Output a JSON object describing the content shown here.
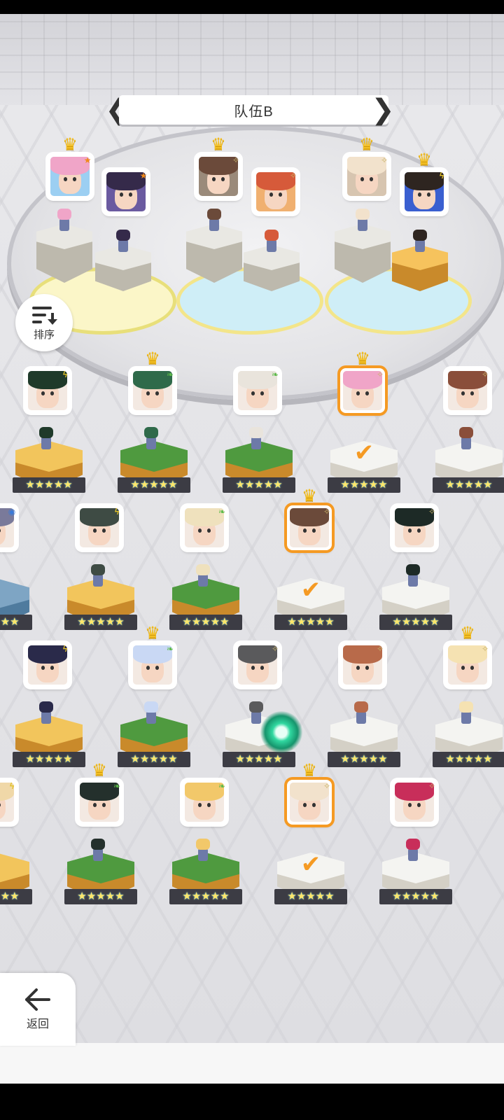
{
  "title": "队伍B",
  "nav": {
    "prev_symbol": "❮",
    "next_symbol": "❯"
  },
  "sort_button": {
    "label": "排序",
    "icon": "sort-icon"
  },
  "back_button": {
    "label": "返回",
    "icon": "back-arrow-icon"
  },
  "star_glyph": "★★★★★",
  "team": [
    {
      "slot": 1,
      "crown": true,
      "element": "star",
      "hair": "#f0a5c8",
      "accent": "#9ccff2"
    },
    {
      "slot": 2,
      "crown": false,
      "element": "star",
      "hair": "#352a4a",
      "accent": "#6a5aa0"
    },
    {
      "slot": 3,
      "crown": true,
      "element": "sparkle",
      "hair": "#6b4a3a",
      "accent": "#9a8a7a"
    },
    {
      "slot": 4,
      "crown": false,
      "element": "sparkle",
      "hair": "#d65a3a",
      "accent": "#f0b070"
    },
    {
      "slot": 5,
      "crown": true,
      "element": "sparkle",
      "hair": "#f2e2cc",
      "accent": "#d7c5b0"
    },
    {
      "slot": 6,
      "crown": true,
      "element": "lightning",
      "hair": "#2e2520",
      "accent": "#3a5fd0"
    }
  ],
  "roster": [
    {
      "row": 1,
      "col": 1,
      "crown": false,
      "element": "lightning",
      "hair": "#1f3a2a",
      "pedestal": "gold",
      "selected": false
    },
    {
      "row": 1,
      "col": 2,
      "crown": true,
      "element": "leaf",
      "hair": "#2f6a4a",
      "pedestal": "green",
      "selected": false
    },
    {
      "row": 1,
      "col": 3,
      "crown": false,
      "element": "leaf",
      "hair": "#e9e4dc",
      "pedestal": "green",
      "selected": false
    },
    {
      "row": 1,
      "col": 4,
      "crown": true,
      "element": "sparkle",
      "hair": "#f0a5c8",
      "pedestal": "white",
      "selected": true
    },
    {
      "row": 1,
      "col": 5,
      "crown": false,
      "element": "sparkle",
      "hair": "#8a4e3a",
      "pedestal": "white",
      "selected": false
    },
    {
      "row": 2,
      "col": 0,
      "crown": false,
      "element": "orb",
      "hair": "#7a7a9a",
      "pedestal": "blue",
      "selected": false
    },
    {
      "row": 2,
      "col": 1,
      "crown": false,
      "element": "lightning",
      "hair": "#3e4b44",
      "pedestal": "gold",
      "selected": false
    },
    {
      "row": 2,
      "col": 2,
      "crown": false,
      "element": "leaf",
      "hair": "#efe1bd",
      "pedestal": "green",
      "selected": false
    },
    {
      "row": 2,
      "col": 3,
      "crown": true,
      "element": "sparkle",
      "hair": "#6b4a3a",
      "pedestal": "white",
      "selected": true
    },
    {
      "row": 2,
      "col": 4,
      "crown": false,
      "element": "sparkle",
      "hair": "#1d2a26",
      "pedestal": "white",
      "selected": false
    },
    {
      "row": 3,
      "col": 1,
      "crown": false,
      "element": "lightning",
      "hair": "#2a2a4a",
      "pedestal": "gold",
      "selected": false
    },
    {
      "row": 3,
      "col": 2,
      "crown": true,
      "element": "leaf",
      "hair": "#c9d8f4",
      "pedestal": "green",
      "selected": false
    },
    {
      "row": 3,
      "col": 3,
      "crown": false,
      "element": "sparkle",
      "hair": "#5a5a5c",
      "pedestal": "white",
      "selected": false
    },
    {
      "row": 3,
      "col": 4,
      "crown": false,
      "element": "sparkle",
      "hair": "#b86a4a",
      "pedestal": "white",
      "selected": false
    },
    {
      "row": 3,
      "col": 5,
      "crown": true,
      "element": "sparkle",
      "hair": "#f5e2b2",
      "pedestal": "white",
      "selected": false
    },
    {
      "row": 4,
      "col": 0,
      "crown": false,
      "element": "lightning",
      "hair": "#f0d8a8",
      "pedestal": "gold",
      "selected": false
    },
    {
      "row": 4,
      "col": 1,
      "crown": true,
      "element": "leaf",
      "hair": "#24302c",
      "pedestal": "green",
      "selected": false
    },
    {
      "row": 4,
      "col": 2,
      "crown": false,
      "element": "leaf",
      "hair": "#f2c86a",
      "pedestal": "green",
      "selected": false
    },
    {
      "row": 4,
      "col": 3,
      "crown": true,
      "element": "sparkle",
      "hair": "#f2e2cc",
      "pedestal": "white",
      "selected": true
    },
    {
      "row": 4,
      "col": 4,
      "crown": false,
      "element": "sparkle",
      "hair": "#c82e5a",
      "pedestal": "white",
      "selected": false
    }
  ],
  "colors": {
    "selected_border": "#f59a23",
    "crown": "#f5c124",
    "stars": "#ffe76a"
  }
}
